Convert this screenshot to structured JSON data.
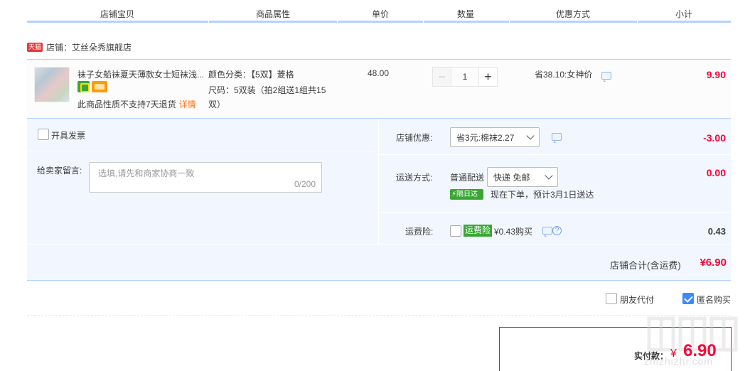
{
  "header": {
    "col_item": "店铺宝贝",
    "col_attr": "商品属性",
    "col_price": "单价",
    "col_qty": "数量",
    "col_promo": "优惠方式",
    "col_subtotal": "小计"
  },
  "shop": {
    "badge": "天猫",
    "name": "店铺：艾丝朵秀旗舰店"
  },
  "item": {
    "title": "袜子女船袜夏天薄款女士短袜浅...",
    "no_return": "此商品性质不支持7天退货",
    "details_link": "详情",
    "attr_color": "颜色分类：【5双】菱格",
    "attr_size": "尺码：5双装（拍2组送1组共15双）",
    "unit_price": "48.00",
    "quantity": "1",
    "minus": "−",
    "plus": "+",
    "promo": "省38.10:女神价",
    "subtotal": "9.90"
  },
  "order": {
    "invoice_label": "开具发票",
    "message_label": "给卖家留言:",
    "message_placeholder": "选填,请先和商家协商一致",
    "message_count": "0/200",
    "shop_discount_label": "店铺优惠:",
    "shop_discount_value": "省3元:棉袜2.27",
    "shop_discount_amount": "-3.00",
    "shipping_label": "运送方式:",
    "shipping_type": "普通配送",
    "shipping_select": "快递 免邮",
    "shipping_amount": "0.00",
    "next_day_badge": "隔日达",
    "shipping_eta": "现在下单，预计3月1日送达",
    "insurance_label": "运费险:",
    "insurance_tag": "运费险",
    "insurance_price": "¥0.43购买",
    "insurance_amount": "0.43",
    "help": "?"
  },
  "total": {
    "label": "店铺合计(含运费)",
    "amount": "¥6.90"
  },
  "options": {
    "friend_pay": "朋友代付",
    "friend_pay_checked": false,
    "anonymous": "匿名购买",
    "anonymous_checked": true
  },
  "pay": {
    "label": "实付款：",
    "currency": "¥",
    "amount": "6.90"
  },
  "watermark": "zhizhizhi.com",
  "colors": {
    "accent_red": "#ff0036",
    "line_blue": "#b2d1ff",
    "panel_bg": "#f2f7ff",
    "check_blue": "#3d8af7"
  }
}
